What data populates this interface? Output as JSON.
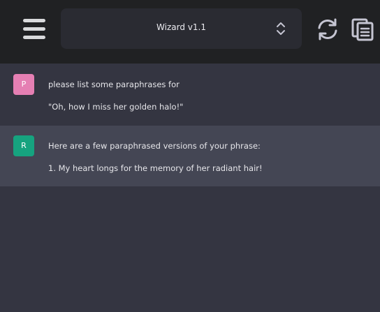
{
  "header": {
    "model_name": "Wizard v1.1",
    "icons": [
      "menu-icon",
      "chevron-updown-icon",
      "refresh-icon",
      "copy-icon"
    ]
  },
  "messages": [
    {
      "role": "user",
      "avatar_letter": "P",
      "avatar_color": "#e57fb3",
      "lines": [
        "please list some paraphrases for",
        "\"Oh, how I miss her golden halo!\""
      ]
    },
    {
      "role": "assistant",
      "avatar_letter": "R",
      "avatar_color": "#16a37f",
      "lines": [
        "Here are a few paraphrased versions of your phrase:",
        "1. My heart longs for the memory of her radiant hair!"
      ]
    }
  ],
  "colors": {
    "header_bg": "#202123",
    "chat_bg": "#343541",
    "assistant_bg": "#444654"
  }
}
